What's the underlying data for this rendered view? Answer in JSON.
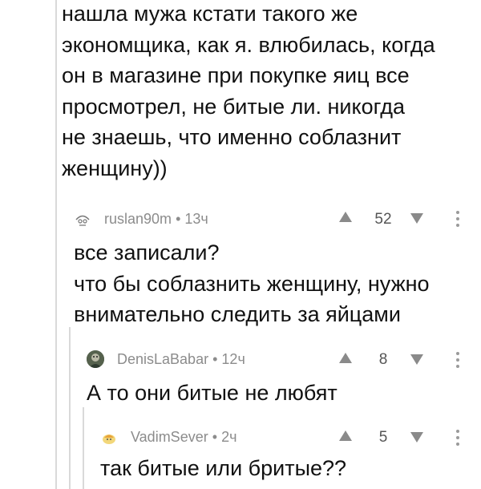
{
  "parent_comment": {
    "lines": [
      "нашла мужа кстати такого же",
      "экономщика, как я. влюбилась, когда",
      "он в магазине при покупке яиц все",
      "просмотрел, не битые ли. никогда",
      "не знаешь, что именно соблазнит",
      "женщину))"
    ]
  },
  "comments": [
    {
      "author": "ruslan90m",
      "time": "13ч",
      "rating": "52",
      "lines": [
        "все записали?",
        "что бы соблазнить женщину, нужно",
        "внимательно следить за яйцами"
      ]
    },
    {
      "author": "DenisLaBabar",
      "time": "12ч",
      "rating": "8",
      "lines": [
        "А то они битые не любят"
      ]
    },
    {
      "author": "VadimSever",
      "time": "2ч",
      "rating": "5",
      "lines": [
        "так битые или бритые??"
      ]
    }
  ],
  "meta_separator": "•",
  "colors": {
    "thread_line": "#d9d9d9",
    "meta_text": "#8c8c8c",
    "vote_arrow": "#8a8a8a"
  },
  "icons": {
    "vote_up": "triangle-up-icon",
    "vote_down": "triangle-down-icon",
    "more": "vertical-dots-icon"
  }
}
